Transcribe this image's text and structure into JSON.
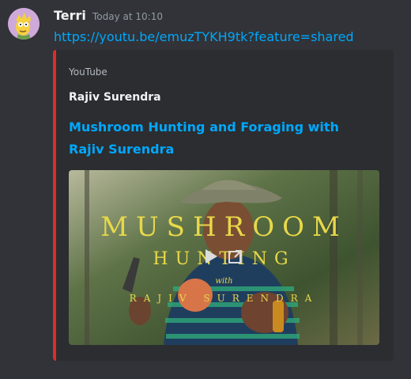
{
  "message": {
    "author": "Terri",
    "timestamp": "Today at 10:10",
    "link": "https://youtu.be/emuzTYKH9tk?feature=shared"
  },
  "embed": {
    "provider": "YouTube",
    "author": "Rajiv Surendra",
    "title": "Mushroom Hunting and Foraging with Rajiv Surendra",
    "accent_color": "#e02b2b",
    "thumbnail_text": {
      "line1": "MUSHROOM",
      "line2": "HUNTING",
      "line3": "with",
      "line4": "RAJIV SURENDRA"
    },
    "controls": [
      "play-icon",
      "open-external-icon"
    ]
  },
  "colors": {
    "background": "#313338",
    "embed_background": "#2b2d31",
    "link": "#00a8fc",
    "thumbnail_text": "#e8d84a"
  }
}
